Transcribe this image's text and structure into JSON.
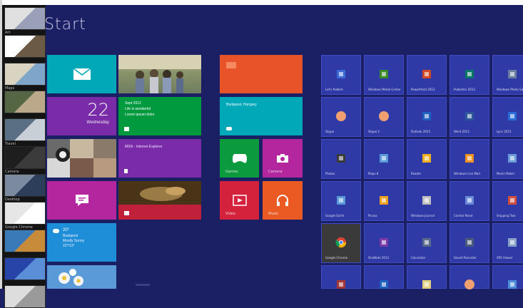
{
  "screen": {
    "title": "Start"
  },
  "switcher": {
    "items": [
      {
        "label": "Art",
        "colors": [
          "#e0e0e0",
          "#9aa0b8"
        ]
      },
      {
        "label": "",
        "colors": [
          "#ffffff",
          "#6b5a46"
        ]
      },
      {
        "label": "Maps",
        "colors": [
          "#d9d3c2",
          "#7fa6c9"
        ]
      },
      {
        "label": "",
        "colors": [
          "#556644",
          "#bba88a"
        ]
      },
      {
        "label": "Travel",
        "colors": [
          "#5a6e84",
          "#c8cfd6"
        ]
      },
      {
        "label": "Camera",
        "colors": [
          "#1e1e1e",
          "#3b3b3b"
        ]
      },
      {
        "label": "Desktop",
        "colors": [
          "#7c8aa0",
          "#2d3e5a"
        ]
      },
      {
        "label": "Google Chrome",
        "colors": [
          "#e6e6e6",
          "#ffffff"
        ]
      },
      {
        "label": "",
        "colors": [
          "#3a7ab8",
          "#c78b3a"
        ]
      },
      {
        "label": "",
        "colors": [
          "#2744a8",
          "#5a8fd8"
        ]
      },
      {
        "label": "",
        "colors": [
          "#dddddd",
          "#9a9a9a"
        ]
      }
    ]
  },
  "tiles": {
    "mail": {
      "label": "",
      "color": "#00a8b8"
    },
    "photos_top": {
      "label": "",
      "color": "#8aa07a"
    },
    "calendar": {
      "day": "22",
      "weekday": "Wednesday",
      "color": "#7a2ba8"
    },
    "messaging": {
      "lines": [
        "Sept 2012",
        "Life is wonderful",
        "Lorem ipsum dolor"
      ],
      "color": "#009a3e"
    },
    "people": {
      "label": "",
      "color": "#3a3a3a"
    },
    "ie": {
      "label": "MSN - Internet Explorer",
      "color": "#7a2ba8"
    },
    "chat": {
      "label": "",
      "color": "#b4269e"
    },
    "news": {
      "label": "",
      "color": "#c0203a"
    },
    "weather": {
      "lines": [
        "20°",
        "Budapest",
        "Mostly Sunny",
        "22°/13°"
      ],
      "color": "#1f8ed8"
    },
    "flowers": {
      "label": "",
      "color": "#4a8fd0"
    },
    "store": {
      "label": "",
      "color": "#e8532a"
    },
    "bing": {
      "label": "Budapest, Hungary",
      "color": "#00a8b8"
    },
    "games": {
      "label": "Games",
      "color": "#0b9b3e"
    },
    "camera": {
      "label": "Camera",
      "color": "#b4269e"
    },
    "video": {
      "label": "Video",
      "color": "#d4223c"
    },
    "music": {
      "label": "Music",
      "color": "#ea5a22"
    }
  },
  "apps": [
    {
      "label": "Let's Publish",
      "icon": "logo-icon",
      "color": "#3a6ad8"
    },
    {
      "label": "Windows Media Center",
      "icon": "media-icon",
      "color": "#3d8a2a"
    },
    {
      "label": "PowerPoint 2013",
      "icon": "powerpoint-icon",
      "color": "#d24726"
    },
    {
      "label": "Publisher 2013",
      "icon": "publisher-icon",
      "color": "#077568"
    },
    {
      "label": "Windows Photo Gallery",
      "icon": "gallery-icon",
      "color": "#6a7fa0"
    },
    {
      "label": "Skype",
      "icon": "circle-icon",
      "color": "#f0a070"
    },
    {
      "label": "Skype 2",
      "icon": "circle-icon",
      "color": "#f0a070"
    },
    {
      "label": "Outlook 2013",
      "icon": "outlook-icon",
      "color": "#1f5fbf"
    },
    {
      "label": "Word 2013",
      "icon": "word-icon",
      "color": "#2b579a"
    },
    {
      "label": "Lync 2013",
      "icon": "lync-icon",
      "color": "#2a6ad8"
    },
    {
      "label": "Photos",
      "icon": "photo-icon",
      "color": "#3a3a3a"
    },
    {
      "label": "Maps 8",
      "icon": "map-icon",
      "color": "#5a9ad8"
    },
    {
      "label": "Reader",
      "icon": "flag-icon",
      "color": "#f0b020"
    },
    {
      "label": "Windows Live Mail",
      "icon": "mail-icon",
      "color": "#f09020"
    },
    {
      "label": "Movie Maker",
      "icon": "movie-icon",
      "color": "#6a9ad8"
    },
    {
      "label": "Google Earth",
      "icon": "earth-icon",
      "color": "#5a9ad8"
    },
    {
      "label": "Picasa",
      "icon": "picasa-icon",
      "color": "#f0a020"
    },
    {
      "label": "Windows Journal",
      "icon": "journal-icon",
      "color": "#c0c0c0"
    },
    {
      "label": "Control Panel",
      "icon": "control-icon",
      "color": "#6a8ad8"
    },
    {
      "label": "Snipping Tool",
      "icon": "snip-icon",
      "color": "#d05040"
    },
    {
      "label": "Google Chrome",
      "icon": "chrome-icon",
      "color": "#ffffff"
    },
    {
      "label": "OneNote 2013",
      "icon": "onenote-icon",
      "color": "#7a3aa8"
    },
    {
      "label": "Calculator",
      "icon": "calc-icon",
      "color": "#5a6a8a"
    },
    {
      "label": "Sound Recorder",
      "icon": "rec-icon",
      "color": "#4a5a7a"
    },
    {
      "label": "XPS Viewer",
      "icon": "xps-icon",
      "color": "#8aa0c8"
    },
    {
      "label": "Access 2013",
      "icon": "access-icon",
      "color": "#a4373a"
    },
    {
      "label": "Outlook",
      "icon": "outlook-icon",
      "color": "#1f5fbf"
    },
    {
      "label": "Paint",
      "icon": "paint-icon",
      "color": "#e0d080"
    },
    {
      "label": "Skype",
      "icon": "circle-icon",
      "color": "#f0a070"
    },
    {
      "label": "Remote Desktop",
      "icon": "remote-icon",
      "color": "#4a8ad8"
    }
  ]
}
